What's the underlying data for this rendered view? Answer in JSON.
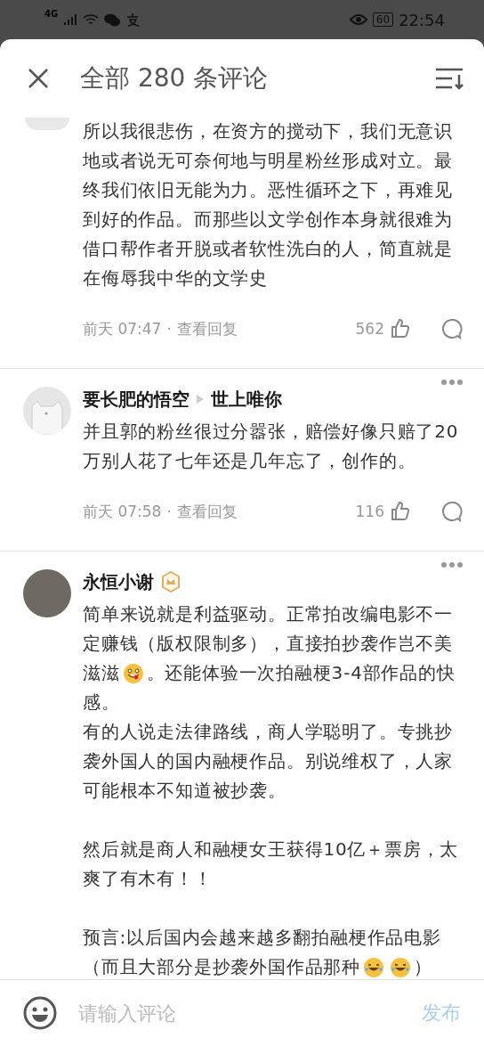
{
  "status_bar": {
    "network": "4G",
    "battery": "60",
    "time": "22:54"
  },
  "header": {
    "title": "全部 280 条评论"
  },
  "comments": [
    {
      "kind": "continued",
      "avatar": {
        "kind": "blank"
      },
      "paragraphs": [
        {
          "spaced": false,
          "text": "所以我很悲伤，在资方的搅动下，我们无意识地或者说无可奈何地与明星粉丝形成对立。最终我们依旧无能为力。恶性循环之下，再难见到好的作品。而那些以文学创作本身就很难为借口帮作者开脱或者软性洗白的人，简直就是在侮辱我中华的文学史"
        }
      ],
      "time": "前天 07:47",
      "separator": "·",
      "replies": "查看回复",
      "likes": "562"
    },
    {
      "kind": "reply",
      "author": "要长肥的悟空",
      "reply_to": "世上唯你",
      "badge": false,
      "avatar": {
        "kind": "cat"
      },
      "paragraphs": [
        {
          "spaced": false,
          "text": "并且郭的粉丝很过分嚣张，赔偿好像只赔了20万别人花了七年还是几年忘了，创作的。"
        }
      ],
      "time": "前天 07:58",
      "separator": "·",
      "replies": "查看回复",
      "likes": "116"
    },
    {
      "kind": "plain",
      "author": "永恒小谢",
      "badge": true,
      "avatar": {
        "kind": "photo"
      },
      "paragraphs": [
        {
          "spaced": false,
          "lines": [
            [
              {
                "kind": "text",
                "text": "简单来说就是利益驱动。正常拍改编电影不一"
              }
            ],
            [
              {
                "kind": "text",
                "text": "定赚钱（版权限制多），直接拍抄袭作岂不美"
              }
            ],
            [
              {
                "kind": "text",
                "text": "滋滋"
              },
              {
                "kind": "yum"
              },
              {
                "kind": "text",
                "text": "。还能体验一次拍融梗3-4部作品的快"
              }
            ],
            [
              {
                "kind": "text",
                "text": "感。"
              }
            ]
          ]
        },
        {
          "spaced": false,
          "text": "有的人说走法律路线，商人学聪明了。专挑抄袭外国人的国内融梗作品。别说维权了，人家可能根本不知道被抄袭。"
        },
        {
          "spaced": true,
          "text": "然后就是商人和融梗女王获得10亿＋票房，太爽了有木有！！"
        },
        {
          "spaced": true,
          "lines": [
            [
              {
                "kind": "text",
                "text": "预言:以后国内会越来越多翻拍融梗作品电影"
              }
            ],
            [
              {
                "kind": "text",
                "text": "（而且大部分是抄袭外国作品那种"
              },
              {
                "kind": "rofl"
              },
              {
                "kind": "rofl"
              },
              {
                "kind": "text",
                "text": "）"
              }
            ]
          ]
        }
      ]
    }
  ],
  "input": {
    "placeholder": "请输入评论",
    "send": "发布"
  }
}
